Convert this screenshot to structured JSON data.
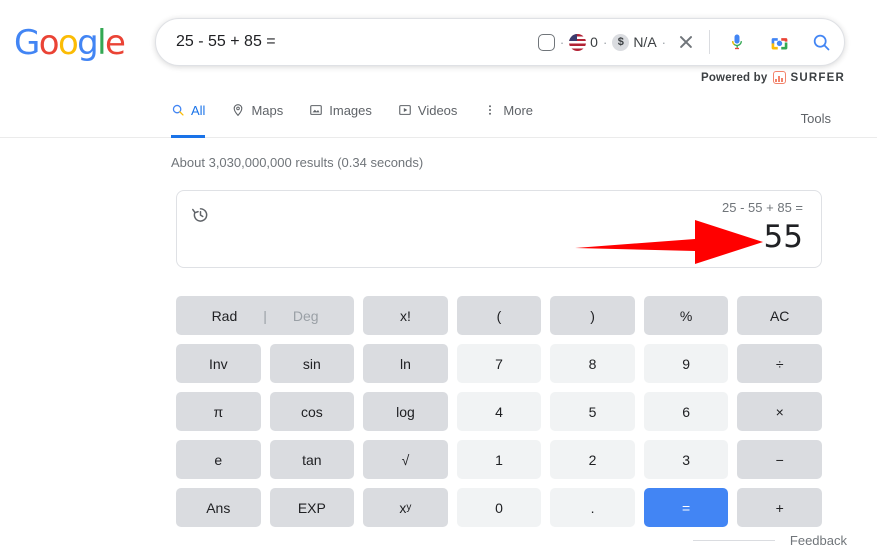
{
  "brand": {
    "logo_letters": [
      "G",
      "o",
      "o",
      "g",
      "l",
      "e"
    ],
    "powered_by_label": "Powered by",
    "powered_by_brand": "SURFER",
    "powered_by_icon": "bar-chart-icon",
    "accent_blue": "#4285F4",
    "link_blue": "#1a73e8",
    "arrow_red": "#FF0000"
  },
  "search": {
    "query": "25 - 55 + 85 =",
    "placeholder": "Search",
    "checkbox_checked": false,
    "flag_icon": "us-flag-icon",
    "flag_count": "0",
    "currency_badge": "$",
    "currency_value": "N/A",
    "separator": "·",
    "clear_icon": "close-icon",
    "mic_icon": "microphone-icon",
    "lens_icon": "camera-lens-icon",
    "search_icon": "search-icon"
  },
  "nav": {
    "tabs": [
      {
        "label": "All",
        "icon": "search-icon",
        "active": true
      },
      {
        "label": "Maps",
        "icon": "map-pin-icon",
        "active": false
      },
      {
        "label": "Images",
        "icon": "image-icon",
        "active": false
      },
      {
        "label": "Videos",
        "icon": "video-icon",
        "active": false
      },
      {
        "label": "More",
        "icon": "more-vertical-icon",
        "active": false
      }
    ],
    "tools_label": "Tools"
  },
  "results": {
    "stats": "About 3,030,000,000 results (0.34 seconds)"
  },
  "calculator": {
    "history_icon": "history-icon",
    "expression": "25 - 55 + 85 =",
    "result": "55",
    "annotation_arrow": "red-arrow-pointing-right",
    "keys": {
      "rad_label": "Rad",
      "divider": "|",
      "deg_label": "Deg",
      "row1": [
        "x!",
        "(",
        ")",
        "%",
        "AC"
      ],
      "row2": [
        "Inv",
        "sin",
        "ln",
        "7",
        "8",
        "9",
        "÷"
      ],
      "row3": [
        "π",
        "cos",
        "log",
        "4",
        "5",
        "6",
        "×"
      ],
      "row4": [
        "e",
        "tan",
        "√",
        "1",
        "2",
        "3",
        "−"
      ],
      "row5_fn": [
        "Ans",
        "EXP"
      ],
      "power_base": "x",
      "power_exp": "y",
      "row5_num": [
        "0",
        "."
      ],
      "equals": "=",
      "plus": "+"
    }
  },
  "footer": {
    "feedback_label": "Feedback"
  }
}
